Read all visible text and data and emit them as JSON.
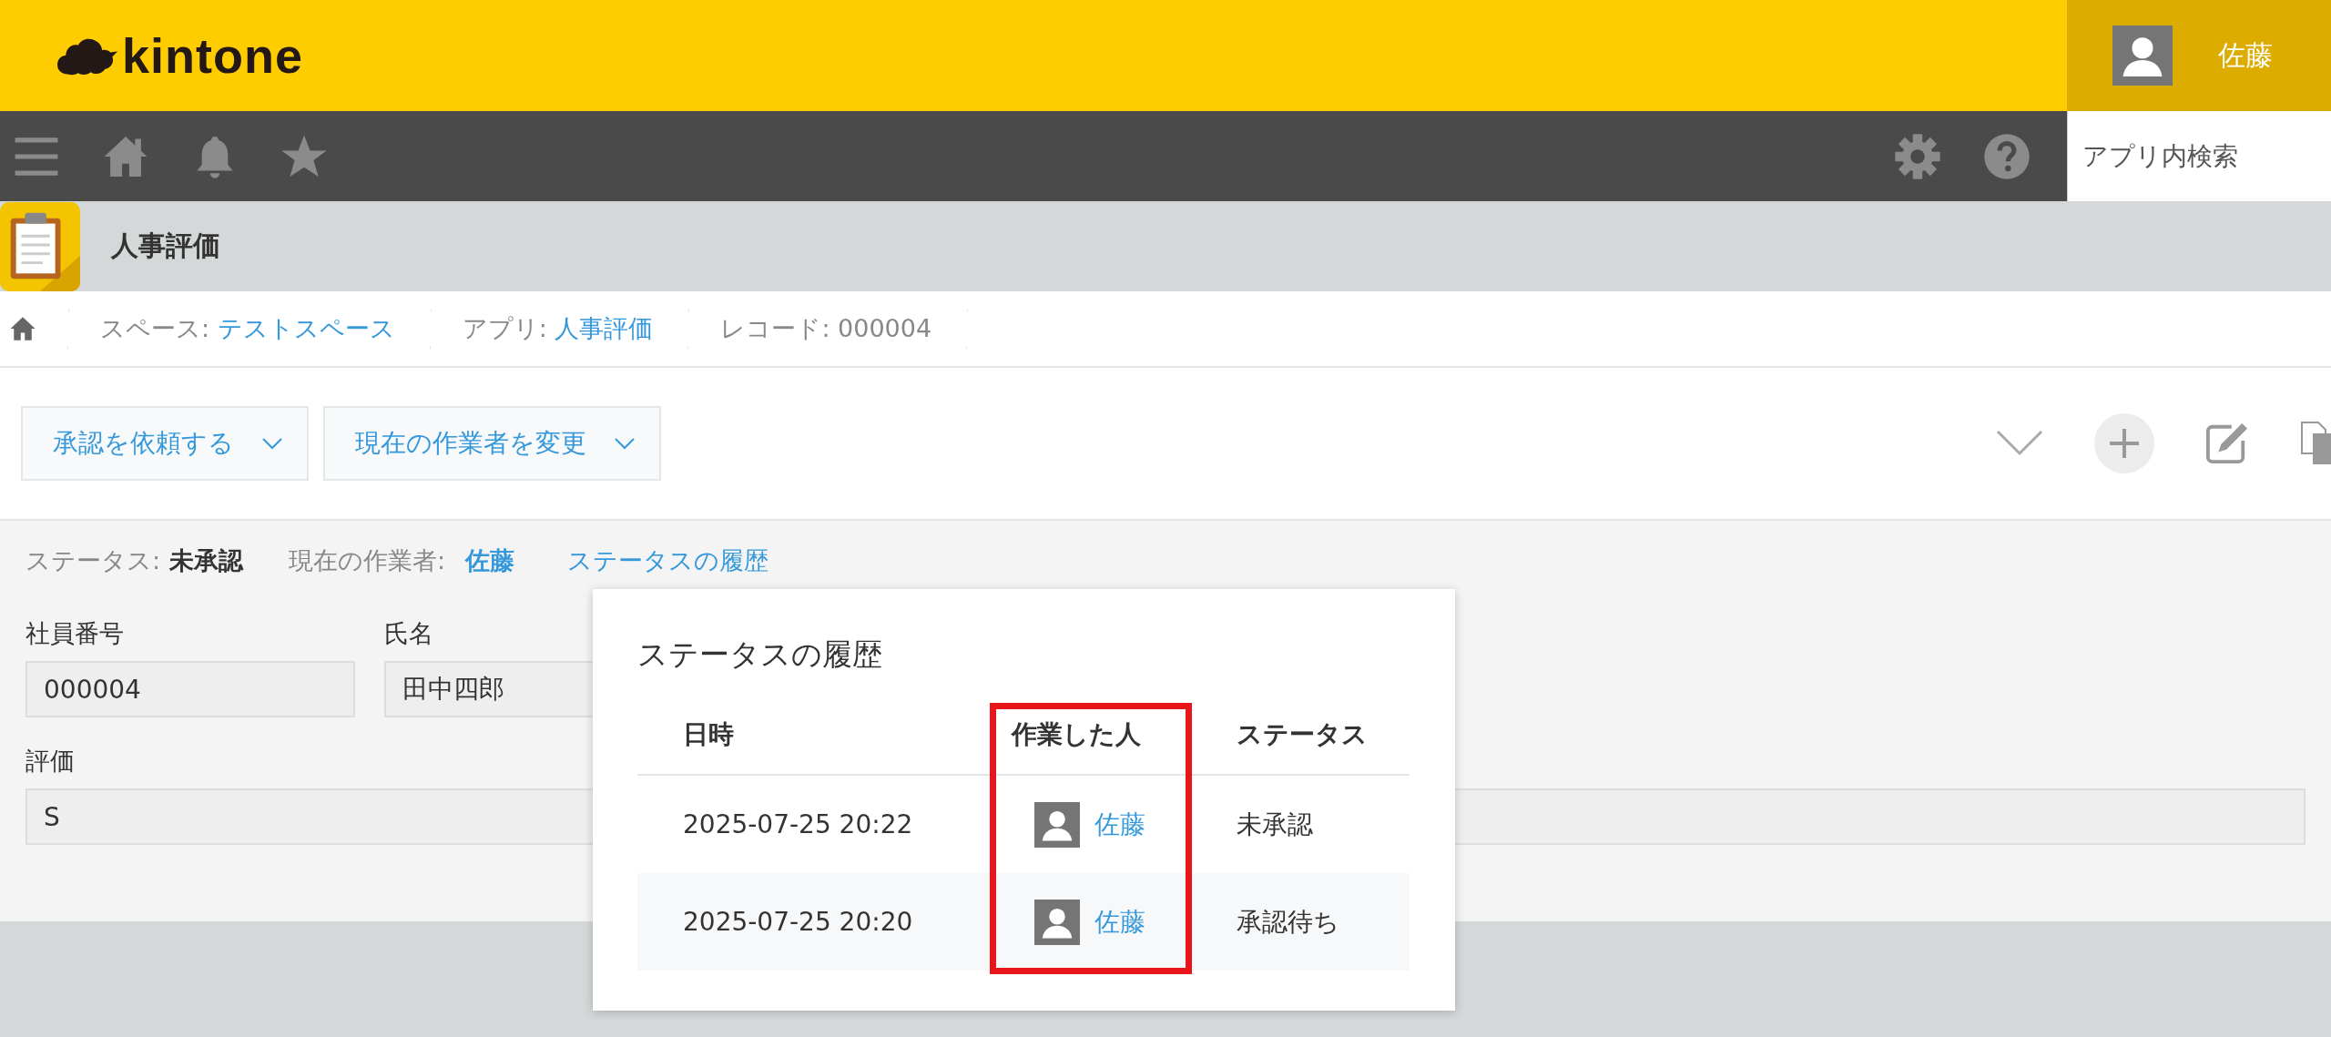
{
  "header": {
    "logo_text": "kintone",
    "user_name": "佐藤"
  },
  "nav": {
    "search": {
      "placeholder": "アプリ内検索"
    }
  },
  "app": {
    "title": "人事評価"
  },
  "breadcrumbs": [
    {
      "label": "スペース: ",
      "link": "テストスペース"
    },
    {
      "label": "アプリ: ",
      "link": "人事評価"
    },
    {
      "label": "レコード: 000004"
    }
  ],
  "actions": [
    {
      "label": "承認を依頼する"
    },
    {
      "label": "現在の作業者を変更"
    }
  ],
  "status_bar": {
    "status_label": "ステータス:",
    "status": "未承認",
    "assignee_label": "現在の作業者:",
    "assignee": "佐藤",
    "history_link": "ステータスの履歴"
  },
  "fields": [
    {
      "label": "社員番号",
      "value": "000004",
      "wide": false
    },
    {
      "label": "氏名",
      "value": "田中四郎",
      "wide": false
    },
    {
      "label": "評価",
      "value": "S",
      "wide": true
    }
  ],
  "history_popup": {
    "title": "ステータスの履歴",
    "columns": [
      {
        "label": "日時",
        "highlighted": false
      },
      {
        "label": "作業した人",
        "highlighted": true
      },
      {
        "label": "ステータス",
        "highlighted": false
      }
    ],
    "rows": [
      {
        "datetime": "2025-07-25 20:22",
        "user": "佐藤",
        "status": "未承認"
      },
      {
        "datetime": "2025-07-25 20:20",
        "user": "佐藤",
        "status": "承認待ち"
      }
    ]
  }
}
